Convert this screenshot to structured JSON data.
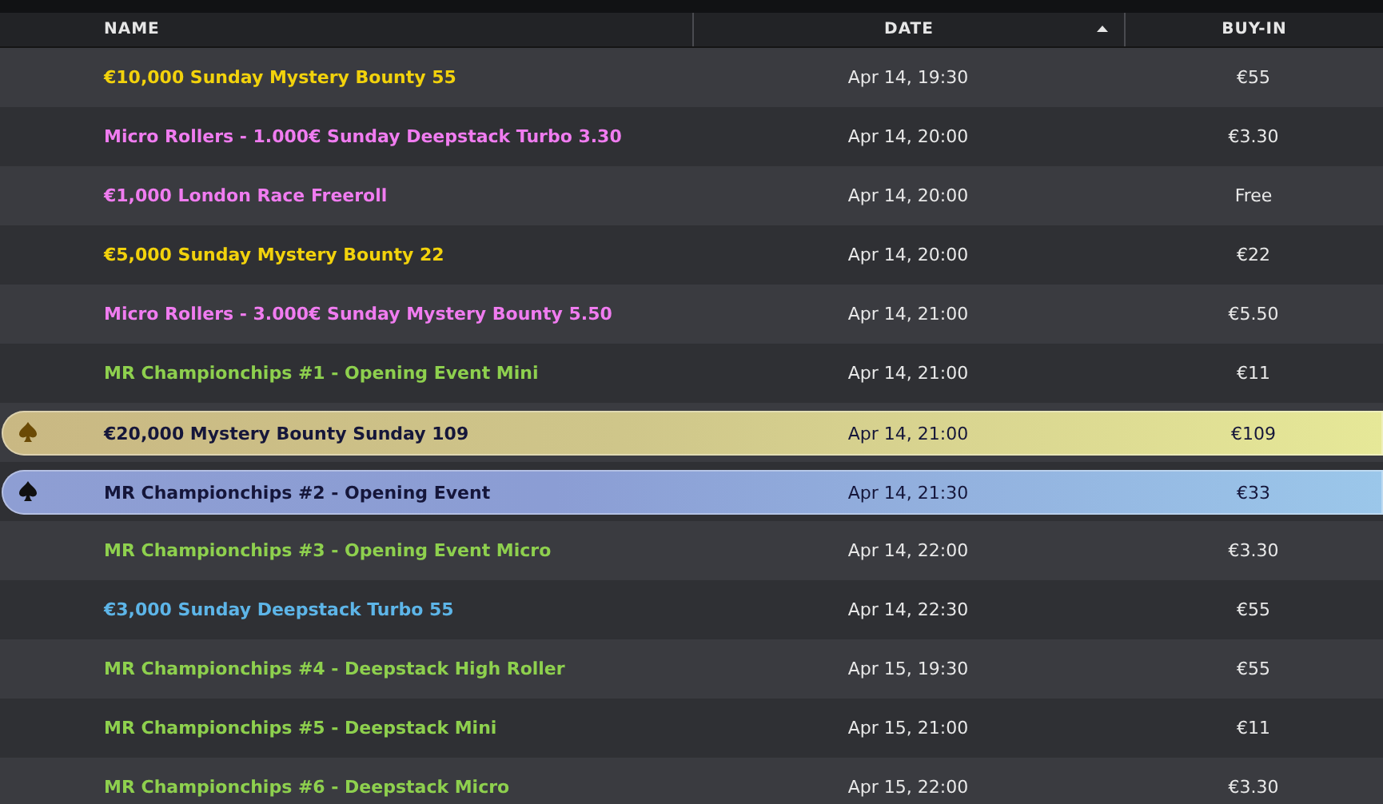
{
  "table": {
    "columns": [
      {
        "label": "NAME",
        "sorted": false
      },
      {
        "label": "DATE",
        "sorted": true
      },
      {
        "label": "BUY-IN",
        "sorted": false
      }
    ],
    "rows": [
      {
        "kind": "plain",
        "color": "#f2d20c",
        "name": "€10,000 Sunday Mystery Bounty 55",
        "date": "Apr 14, 19:30",
        "buy_in": "€55"
      },
      {
        "kind": "plain",
        "color": "#f07cf0",
        "name": "Micro Rollers - 1.000€ Sunday Deepstack Turbo 3.30",
        "date": "Apr 14, 20:00",
        "buy_in": "€3.30"
      },
      {
        "kind": "plain",
        "color": "#f07cf0",
        "name": "€1,000 London Race Freeroll",
        "date": "Apr 14, 20:00",
        "buy_in": "Free"
      },
      {
        "kind": "plain",
        "color": "#f2d20c",
        "name": "€5,000 Sunday Mystery Bounty 22",
        "date": "Apr 14, 20:00",
        "buy_in": "€22"
      },
      {
        "kind": "plain",
        "color": "#f07cf0",
        "name": "Micro Rollers - 3.000€ Sunday Mystery Bounty 5.50",
        "date": "Apr 14, 21:00",
        "buy_in": "€5.50"
      },
      {
        "kind": "plain",
        "color": "#8ed04e",
        "name": "MR Championchips #1 - Opening Event Mini",
        "date": "Apr 14, 21:00",
        "buy_in": "€11"
      },
      {
        "kind": "gold",
        "name": "€20,000 Mystery Bounty Sunday 109",
        "date": "Apr 14, 21:00",
        "buy_in": "€109"
      },
      {
        "kind": "blue",
        "name": "MR Championchips #2 - Opening Event",
        "date": "Apr 14, 21:30",
        "buy_in": "€33"
      },
      {
        "kind": "plain",
        "color": "#8ed04e",
        "name": "MR Championchips #3 - Opening Event Micro",
        "date": "Apr 14, 22:00",
        "buy_in": "€3.30"
      },
      {
        "kind": "plain",
        "color": "#5db5e8",
        "name": "€3,000 Sunday Deepstack Turbo 55",
        "date": "Apr 14, 22:30",
        "buy_in": "€55"
      },
      {
        "kind": "plain",
        "color": "#8ed04e",
        "name": "MR Championchips #4 - Deepstack High Roller",
        "date": "Apr 15, 19:30",
        "buy_in": "€55"
      },
      {
        "kind": "plain",
        "color": "#8ed04e",
        "name": "MR Championchips #5 - Deepstack Mini",
        "date": "Apr 15, 21:00",
        "buy_in": "€11"
      },
      {
        "kind": "plain",
        "color": "#8ed04e",
        "name": "MR Championchips #6 - Deepstack Micro",
        "date": "Apr 15, 22:00",
        "buy_in": "€3.30"
      }
    ]
  }
}
